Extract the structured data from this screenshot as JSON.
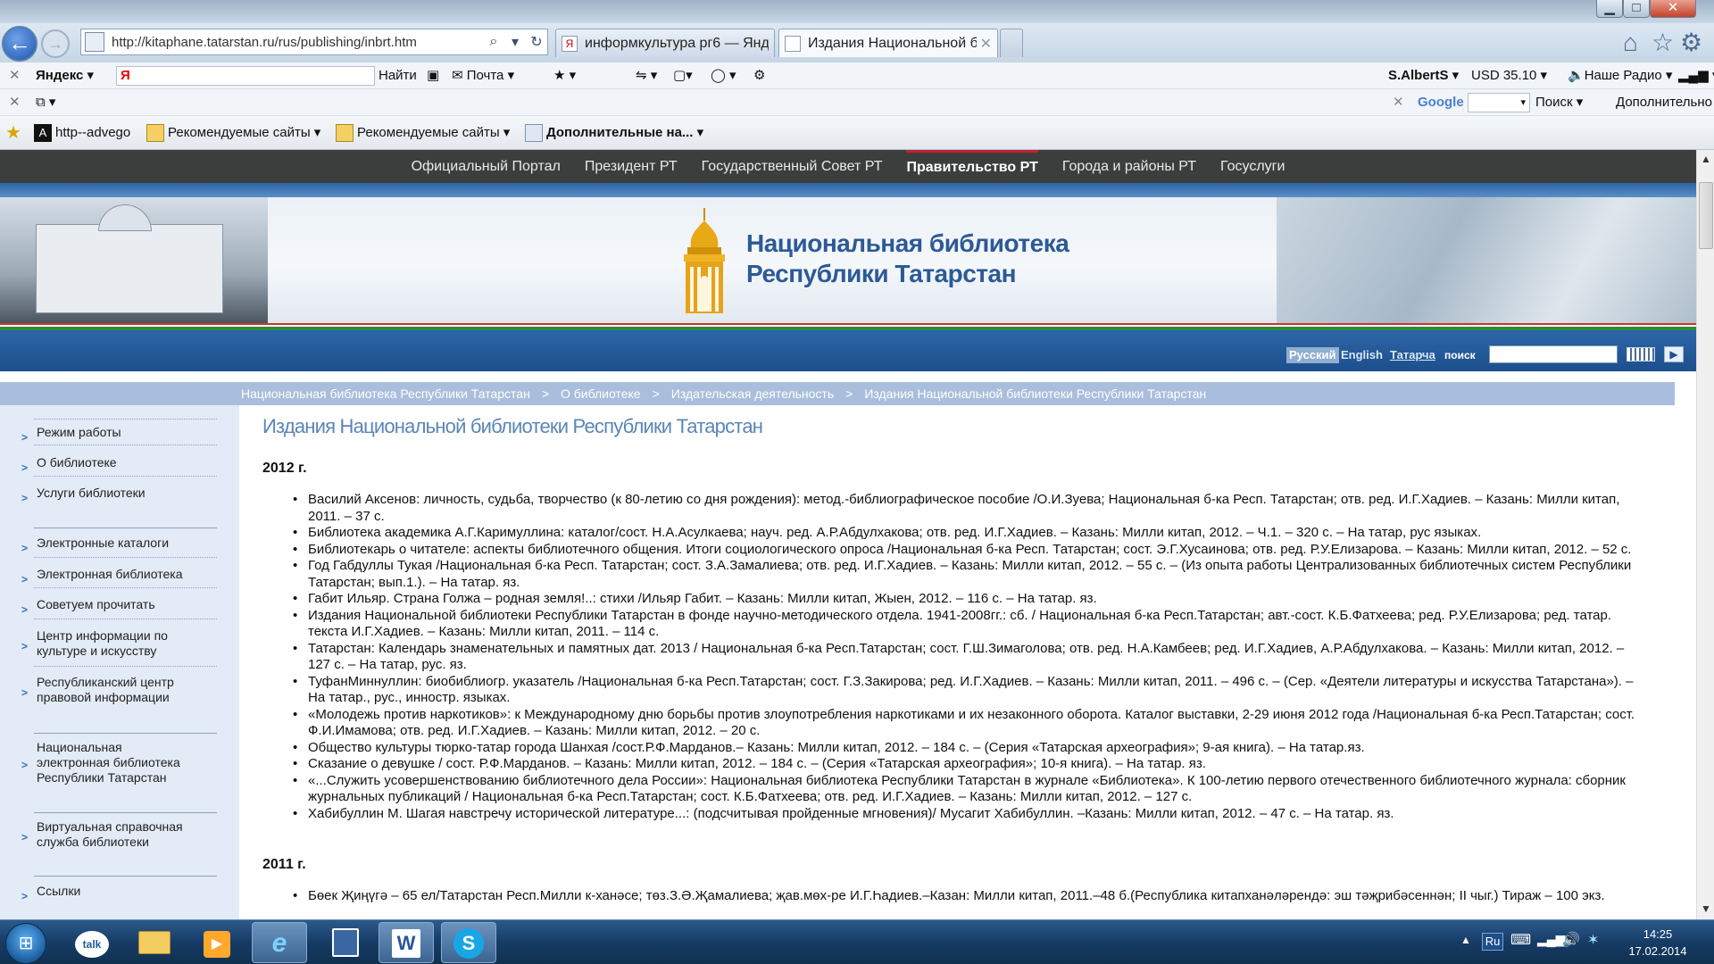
{
  "browser": {
    "url": "http://kitaphane.tatarstan.ru/rus/publishing/inbrt.htm",
    "tabs": [
      {
        "label": "информкультура рг6 — Янде..."
      },
      {
        "label": "Издания Национальной б..."
      }
    ],
    "toolbar1": {
      "yandex_label": "Яндекс",
      "yandex_input": "Я",
      "find_label": "Найти",
      "mail_label": "Почта",
      "user_label": "S.AlbertS",
      "currency_label": "USD 35.10",
      "radio_label": "Наше Радио"
    },
    "toolbar2": {
      "google_label": "Google",
      "search_label": "Поиск",
      "more_label": "Дополнительно"
    },
    "favorites": [
      {
        "label": "http--advego"
      },
      {
        "label": "Рекомендуемые сайты"
      },
      {
        "label": "Рекомендуемые сайты"
      },
      {
        "label": "Дополнительные на..."
      }
    ]
  },
  "gov_nav": [
    {
      "label": "Официальный Портал"
    },
    {
      "label": "Президент РТ"
    },
    {
      "label": "Государственный Совет РТ"
    },
    {
      "label": "Правительство РТ",
      "active": true
    },
    {
      "label": "Города и районы РТ"
    },
    {
      "label": "Госуслуги"
    }
  ],
  "banner": {
    "title_line1": "Национальная библиотека",
    "title_line2": "Республики Татарстан"
  },
  "lang_bar": {
    "russian": "Русский",
    "english": "English",
    "tatar": "Татарча",
    "search_label": "поиск"
  },
  "breadcrumb": [
    {
      "label": "Национальная библиотека Республики Татарстан"
    },
    {
      "label": "О библиотеке"
    },
    {
      "label": "Издательская деятельность"
    },
    {
      "label": "Издания Национальной библиотеки Республики Татарстан"
    }
  ],
  "sidebar": {
    "items": [
      {
        "label": "Режим работы"
      },
      {
        "label": "О библиотеке"
      },
      {
        "label": "Услуги библиотеки"
      },
      {
        "label": "Электронные каталоги"
      },
      {
        "label": "Электронная библиотека"
      },
      {
        "label": "Советуем прочитать"
      },
      {
        "label": "Центр информации по культуре и искусству"
      },
      {
        "label": "Республиканский центр правовой информации"
      },
      {
        "label": "Национальная электронная библиотека Республики Татарстан"
      },
      {
        "label": "Виртуальная справочная служба библиотеки"
      },
      {
        "label": "Ссылки"
      }
    ]
  },
  "content": {
    "page_title": "Издания Национальной библиотеки Республики Татарстан",
    "sections": [
      {
        "year": "2012 г.",
        "items": [
          "Василий Аксенов: личность, судьба, творчество (к 80-летию со дня рождения): метод.-библиографическое пособие /О.И.Зуева; Национальная б-ка Респ. Татарстан; отв. ред. И.Г.Хадиев. – Казань: Милли китап, 2011. – 37 с.",
          "Библиотека академика А.Г.Каримуллина: каталог/сост. Н.А.Асулкаева; науч. ред. А.Р.Абдулхакова; отв. ред. И.Г.Хадиев. – Казань: Милли китап, 2012. – Ч.1. – 320 с. – На татар, рус языках.",
          "Библиотекарь о читателе: аспекты библиотечного общения. Итоги социологического опроса /Национальная б-ка Респ. Татарстан; сост. Э.Г.Хусаинова; отв. ред. Р.У.Елизарова. – Казань: Милли китап, 2012. – 52 с.",
          "Год Габдуллы Тукая /Национальная б-ка Респ. Татарстан; сост. З.А.Замалиева; отв. ред. И.Г.Хадиев. – Казань: Милли китап, 2012. – 55 с. – (Из опыта работы Централизованных библиотечных систем Республики Татарстан; вып.1.). – На татар. яз.",
          "Габит Ильяр. Страна Голжа – родная земля!..: стихи /Ильяр Габит. – Казань: Милли китап, Жыен, 2012. – 116 с. – На татар. яз.",
          "Издания Национальной библиотеки Республики Татарстан в фонде научно-методического отдела. 1941-2008гг.: сб. / Национальная б-ка Респ.Татарстан; авт.-сост. К.Б.Фатхеева; ред. Р.У.Елизарова; ред. татар. текста И.Г.Хадиев. – Казань: Милли китап, 2011. – 114 с.",
          "Татарстан: Календарь знаменательных и памятных дат. 2013 / Национальная б-ка Респ.Татарстан; сост. Г.Ш.Зимаголова; отв. ред. Н.А.Камбеев; ред. И.Г.Хадиев, А.Р.Абдулхакова. – Казань: Милли китап, 2012. – 127 с. – На татар, рус. яз.",
          "ТуфанМиннуллин: биобиблиогр. указатель /Национальная б-ка Респ.Татарстан; сост. Г.З.Закирова; ред. И.Г.Хадиев. – Казань: Милли китап, 2011. – 496 с. – (Сер. «Деятели литературы и искусства Татарстана»). – На татар., рус., инностр. языках.",
          "«Молодежь против наркотиков»: к Международному дню борьбы против злоупотребления наркотиками и их незаконного оборота. Каталог выставки, 2-29 июня 2012 года /Национальная б-ка Респ.Татарстан; сост. Ф.И.Имамова; отв. ред. И.Г.Хадиев. – Казань: Милли китап, 2012. – 20 с.",
          "Общество культуры тюрко-татар города Шанхая /сост.Р.Ф.Марданов.– Казань: Милли китап, 2012. – 184 с. – (Серия «Татарская археография»; 9-ая книга). – На татар.яз.",
          "Сказание о девушке / сост. Р.Ф.Марданов. – Казань: Милли китап, 2012. – 184 с. – (Серия «Татарская археография»; 10-я книга). – На татар. яз.",
          "«...Служить усовершенствованию библиотечного дела России»: Национальная библиотека Республики Татарстан в журнале «Библиотека». К 100-летию первого отечественного библиотечного журнала: сборник журнальных публикаций / Национальная б-ка Респ.Татарстан; сост. К.Б.Фатхеева; отв. ред. И.Г.Хадиев. – Казань: Милли китап, 2012. – 127 с.",
          "Хабибуллин М. Шагая навстречу исторической литературе...: (подсчитывая пройденные мгновения)/ Мусагит Хабибуллин. –Казань: Милли китап, 2012. – 47 с. – На татар. яз."
        ]
      },
      {
        "year": "2011 г.",
        "items": [
          "Бөек Җиңүгә – 65 ел/Татарстан Респ.Милли к-ханәсе; төз.З.Ә.Җамалиева; җав.мөх-ре И.Г.Һадиев.–Казан: Милли китап, 2011.–48 б.(Республика китапханәләрендә: эш тәҗрибәсеннән; II чыг.) Тираж – 100 экз."
        ]
      }
    ]
  },
  "taskbar": {
    "apps": [
      {
        "icon": "talk-icon",
        "label": "talk"
      },
      {
        "icon": "folder-icon",
        "label": ""
      },
      {
        "icon": "media-player-icon",
        "label": ""
      },
      {
        "icon": "ie-icon",
        "label": "e"
      },
      {
        "icon": "save-icon",
        "label": ""
      },
      {
        "icon": "word-icon",
        "label": "W"
      },
      {
        "icon": "skype-icon",
        "label": "S"
      }
    ],
    "language": "Ru",
    "time": "14:25",
    "date": "17.02.2014"
  }
}
